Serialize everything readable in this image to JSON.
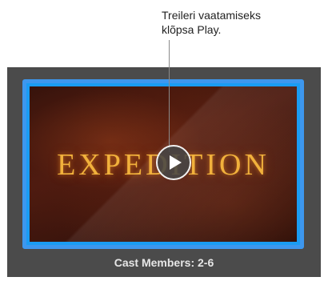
{
  "callout": {
    "line1": "Treileri vaatamiseks",
    "line2": "klõpsa Play."
  },
  "trailer": {
    "title": "EXPEDITION",
    "caption": "Cast Members: 2-6",
    "play_icon": "play-icon",
    "selection_color": "#3d97ee",
    "title_color": "#f1b13c"
  }
}
